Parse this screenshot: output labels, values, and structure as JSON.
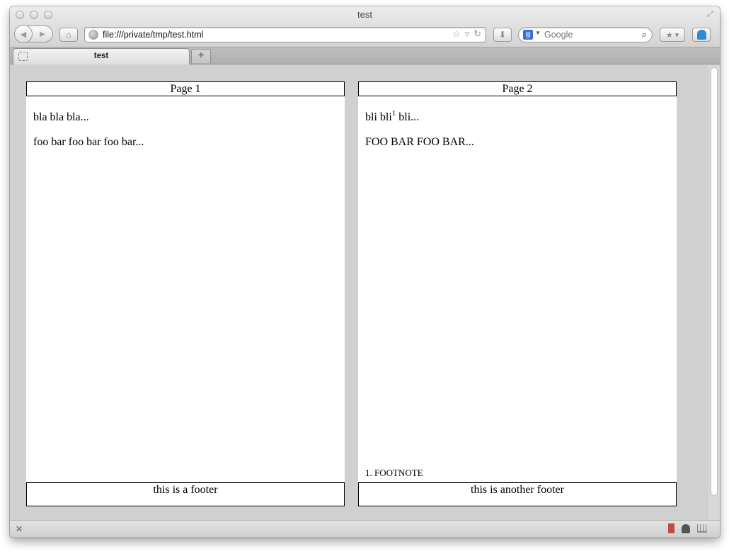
{
  "window": {
    "title": "test"
  },
  "toolbar": {
    "url": "file:///private/tmp/test.html",
    "search_placeholder": "Google"
  },
  "tabs": [
    {
      "label": "test",
      "active": true
    }
  ],
  "pages": [
    {
      "header": "Page 1",
      "paragraphs": [
        "bla bla bla...",
        "foo bar foo bar foo bar..."
      ],
      "footer": "this is a footer"
    },
    {
      "header": "Page 2",
      "para1_start": "bli bli",
      "para1_ref": "1",
      "para1_end": " bli...",
      "para2": "FOO BAR FOO BAR...",
      "footnote": "1. FOOTNOTE",
      "footer": "this is another footer"
    }
  ],
  "icons": {
    "back": "back-arrow-icon",
    "forward": "forward-arrow-icon",
    "home": "home-icon",
    "site": "globe-icon",
    "bookmark_star": "star-icon",
    "reload": "reload-icon",
    "download": "download-icon",
    "search": "magnifier-icon",
    "new_tab": "plus-icon",
    "close_status": "close-icon"
  }
}
